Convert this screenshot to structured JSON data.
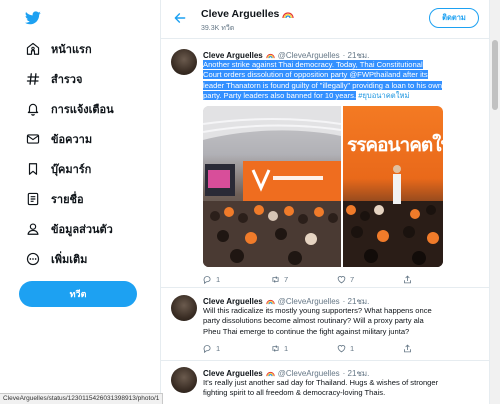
{
  "nav": {
    "items": [
      {
        "label": "หน้าแรก",
        "icon": "home-icon"
      },
      {
        "label": "สำรวจ",
        "icon": "hashtag-icon"
      },
      {
        "label": "การแจ้งเตือน",
        "icon": "bell-icon"
      },
      {
        "label": "ข้อความ",
        "icon": "mail-icon"
      },
      {
        "label": "บุ๊คมาร์ก",
        "icon": "bookmark-icon"
      },
      {
        "label": "รายชื่อ",
        "icon": "list-icon"
      },
      {
        "label": "ข้อมูลส่วนตัว",
        "icon": "profile-icon"
      },
      {
        "label": "เพิ่มเติม",
        "icon": "more-icon"
      }
    ],
    "tweet_button": "ทวีต"
  },
  "header": {
    "name": "Cleve Arguelles",
    "count": "39.3K ทวีต",
    "follow_button": "ติดตาม"
  },
  "tweets": [
    {
      "name": "Cleve Arguelles",
      "handle": "@CleveArguelles",
      "time": "· 21ชม.",
      "text_highlighted": "Another strike against Thai democracy. Today, Thai Constitutional Court orders dissolution of opposition party @FWPthailand after its leader Thanatorn is found guilty of \"illegally\" providing a loan to his own party. Party leaders also banned for 10 years.",
      "text_link": "#ยุบอนาคตใหม่",
      "replies": "1",
      "retweets": "7",
      "likes": "7"
    },
    {
      "name": "Cleve Arguelles",
      "handle": "@CleveArguelles",
      "time": "· 21ชม.",
      "text": "Will this radicalize its mostly young supporters? What happens once party dissolutions become almost routinary? Will a proxy party ala Pheu Thai emerge to continue the fight against military junta?",
      "replies": "1",
      "retweets": "1",
      "likes": "1"
    },
    {
      "name": "Cleve Arguelles",
      "handle": "@CleveArguelles",
      "time": "· 21ชม.",
      "text": "It's really just another sad day for Thailand. Hugs & wishes of stronger fighting spirit to all freedom & democracy-loving Thais."
    }
  ],
  "media": {
    "banner_text": "รรคอนาคตให"
  },
  "status_url": "CleveArguelles/status/1230115426031398913/photo/1",
  "colors": {
    "accent": "#1da1f2",
    "link": "#1b95e0",
    "selection": "#3390ff",
    "party_orange": "#f47a23"
  }
}
